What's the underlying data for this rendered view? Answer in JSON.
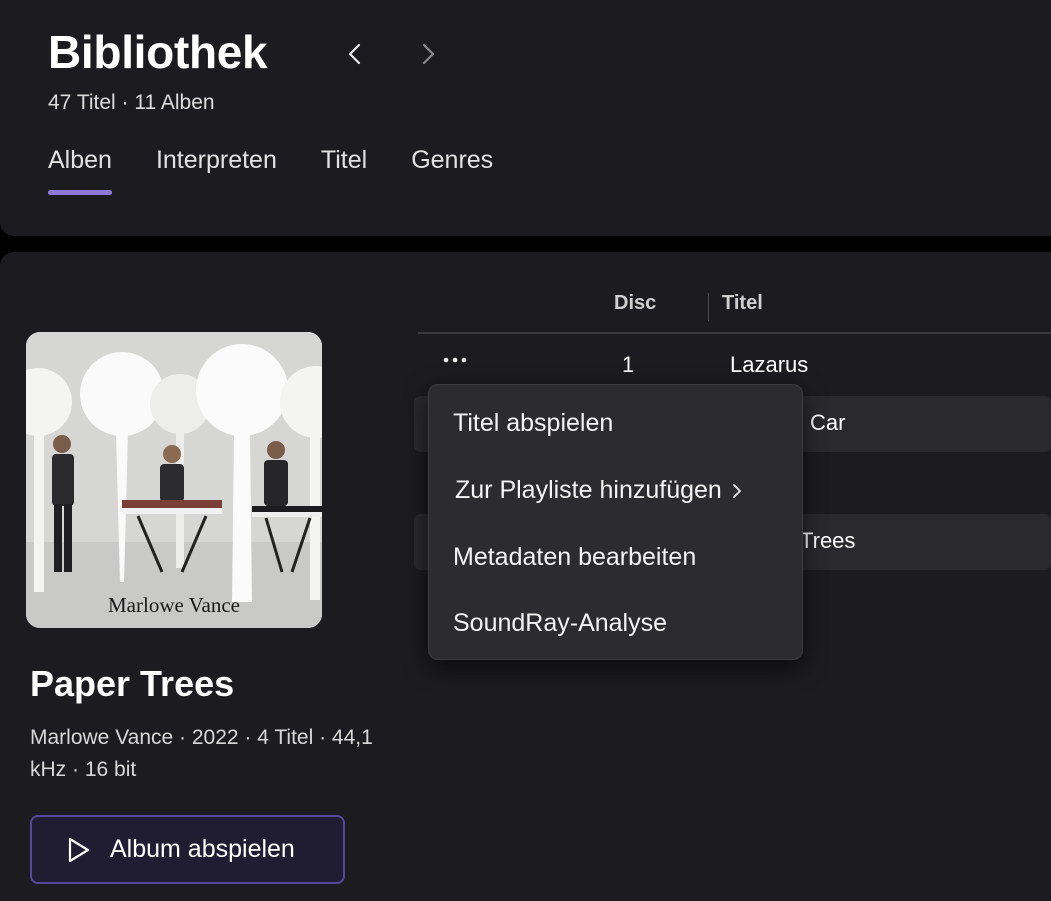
{
  "header": {
    "title": "Bibliothek",
    "subtitle": "47 Titel · 11 Alben",
    "tabs": [
      {
        "label": "Alben",
        "active": true
      },
      {
        "label": "Interpreten",
        "active": false
      },
      {
        "label": "Titel",
        "active": false
      },
      {
        "label": "Genres",
        "active": false
      }
    ],
    "nav_back_icon": "chevron-left-icon",
    "nav_forward_icon": "chevron-right-icon"
  },
  "album": {
    "cover_caption": "Marlowe Vance",
    "title": "Paper Trees",
    "meta": "Marlowe Vance · 2022 · 4 Titel · 44,1 kHz · 16 bit",
    "play_button_label": "Album abspielen",
    "play_icon": "play-icon"
  },
  "table": {
    "headers": {
      "disc": "Disc",
      "title": "Titel"
    },
    "rows": [
      {
        "disc": "1",
        "title": "Lazarus"
      },
      {
        "disc": "",
        "title": "Car"
      },
      {
        "disc": "",
        "title": ""
      },
      {
        "disc": "",
        "title": "Trees"
      }
    ],
    "more_icon": "more-horizontal-icon"
  },
  "context_menu": {
    "items": [
      {
        "label": "Titel abspielen"
      },
      {
        "label": "Zur Playliste hinzufügen",
        "submenu": true
      },
      {
        "label": "Metadaten bearbeiten"
      },
      {
        "label": "SoundRay-Analyse"
      }
    ]
  },
  "colors": {
    "background": "#000000",
    "panel": "#1c1c20",
    "accent": "#8b7ad8",
    "button_border": "#55489a",
    "menu_bg": "#2c2c2e"
  }
}
